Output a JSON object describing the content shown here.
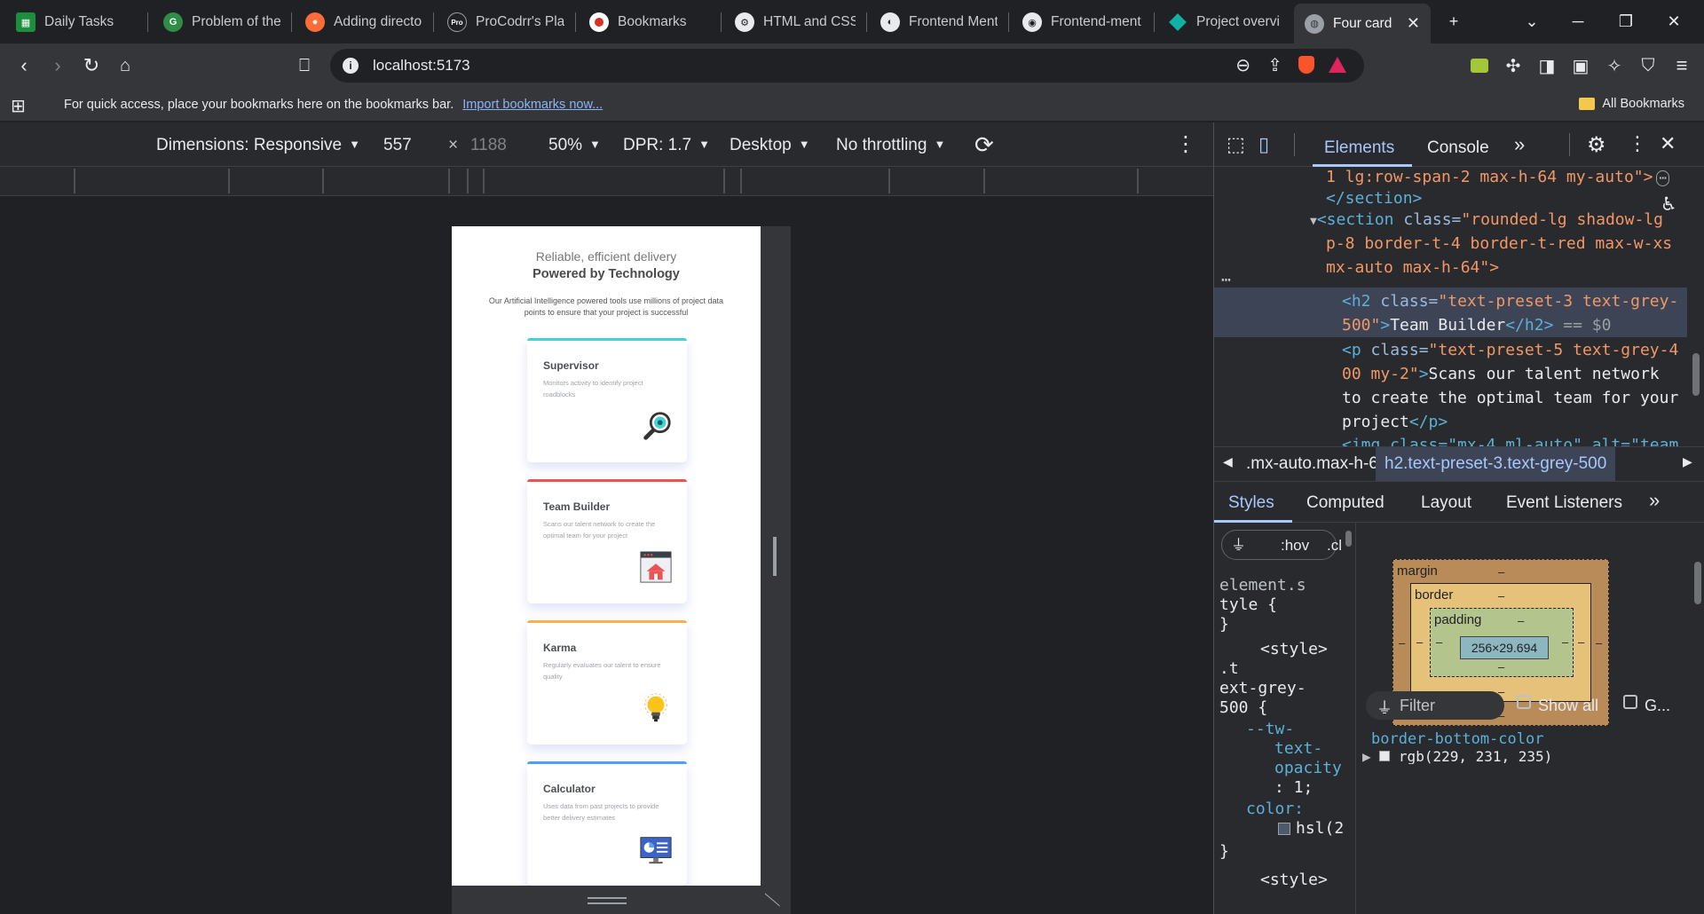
{
  "tabs": [
    {
      "label": "Daily Tasks",
      "icon": "sheets-icon",
      "color": "#1e8e3e"
    },
    {
      "label": "Problem of the",
      "icon": "gfg-icon",
      "color": "#2f8d46"
    },
    {
      "label": "Adding directo",
      "icon": "postman-icon",
      "color": "#ff6c37"
    },
    {
      "label": "ProCodrr's Plat",
      "icon": "procodrr-icon",
      "color": "#555555"
    },
    {
      "label": "Bookmarks",
      "icon": "bookmarks-icon",
      "color": "#d93025"
    },
    {
      "label": "HTML and CSS",
      "icon": "github-cog-icon",
      "color": "#5f6368"
    },
    {
      "label": "Frontend Ment",
      "icon": "frontend-mentor-icon",
      "color": "#e8eaed"
    },
    {
      "label": "Frontend-ment",
      "icon": "github-icon",
      "color": "#e8eaed"
    },
    {
      "label": "Project overvie",
      "icon": "diamond-icon",
      "color": "#10b3a3"
    },
    {
      "label": "Four card f",
      "icon": "globe-icon",
      "color": "#9aa0a6"
    }
  ],
  "toolbar": {
    "url": "localhost:5173"
  },
  "bookmarks_bar": {
    "message": "For quick access, place your bookmarks here on the bookmarks bar.",
    "import_link": "Import bookmarks now...",
    "all_bookmarks": "All Bookmarks"
  },
  "device_toolbar": {
    "dimensions": "Dimensions: Responsive",
    "width": "557",
    "times": "×",
    "height": "1188",
    "zoom": "50%",
    "dpr": "DPR: 1.7",
    "device_type": "Desktop",
    "throttling": "No throttling"
  },
  "page": {
    "subtitle": "Reliable, efficient delivery",
    "title": "Powered by Technology",
    "description": "Our Artificial Intelligence powered tools use millions of project data points to ensure that your project is successful",
    "cards": [
      {
        "title": "Supervisor",
        "desc": "Monitors activity to identify project roadblocks",
        "accent": "#44d3d2",
        "icon": "magnifier-icon"
      },
      {
        "title": "Team Builder",
        "desc": "Scans our talent network to create the optimal team for your project",
        "accent": "#ea5454",
        "icon": "team-builder-icon"
      },
      {
        "title": "Karma",
        "desc": "Regularly evaluates our talent to ensure quality",
        "accent": "#fcaf4a",
        "icon": "lightbulb-icon"
      },
      {
        "title": "Calculator",
        "desc": "Uses data from past projects to provide better delivery estimates",
        "accent": "#549ef2",
        "icon": "calculator-icon"
      }
    ]
  },
  "devtools": {
    "tabs": [
      "Elements",
      "Console"
    ],
    "dom_lines": {
      "l1": "1 lg:row-span-2 max-h-64 my-auto\">",
      "l2": "</section>",
      "l3_tag": "<section ",
      "l3_attr": "class=",
      "l3_val": "\"rounded-lg shadow-lg",
      "l4": "p-8 border-t-4 border-t-red max-w-xs",
      "l5": "mx-auto max-h-64\">",
      "l6_tag": "<h2 ",
      "l6_attr": "class=",
      "l6_val": "\"text-preset-3 text-grey-",
      "l7_val": "500\"",
      "l7_text": "Team Builder",
      "l7_close": "</h2>",
      "l7_eq": "== $0",
      "l8_tag": "<p ",
      "l8_attr": "class=",
      "l8_val": "\"text-preset-5 text-grey-4",
      "l9_val": "00 my-2\"",
      "l9_text": "Scans our talent network",
      "l10": "to create the optimal team for your",
      "l11_text": "project",
      "l11_close": "</p>",
      "l12": "<img class=\"mx-4 ml-auto\" alt=\"team"
    },
    "breadcrumbs": [
      ".mx-auto.max-h-64",
      "h2.text-preset-3.text-grey-500"
    ],
    "style_tabs": [
      "Styles",
      "Computed",
      "Layout",
      "Event Listeners"
    ],
    "styles_filter": ":hov",
    "styles_cls": ".cl",
    "styles_lines": [
      "element.s",
      "tyle {",
      "}",
      "<style>",
      ".t",
      "ext-grey-",
      "500 {",
      "--tw-",
      "text-",
      "opacity",
      ": 1;",
      "color:",
      "hsl(2",
      "}",
      "<style>"
    ],
    "box_model": {
      "margin": "margin",
      "border": "border",
      "padding": "padding",
      "content": "256×29.694",
      "dash": "–"
    },
    "computed_filter": "Filter",
    "show_all": "Show all",
    "group": "G...",
    "computed_prop": "border-bottom-color",
    "computed_val": "rgb(229, 231, 235)"
  }
}
